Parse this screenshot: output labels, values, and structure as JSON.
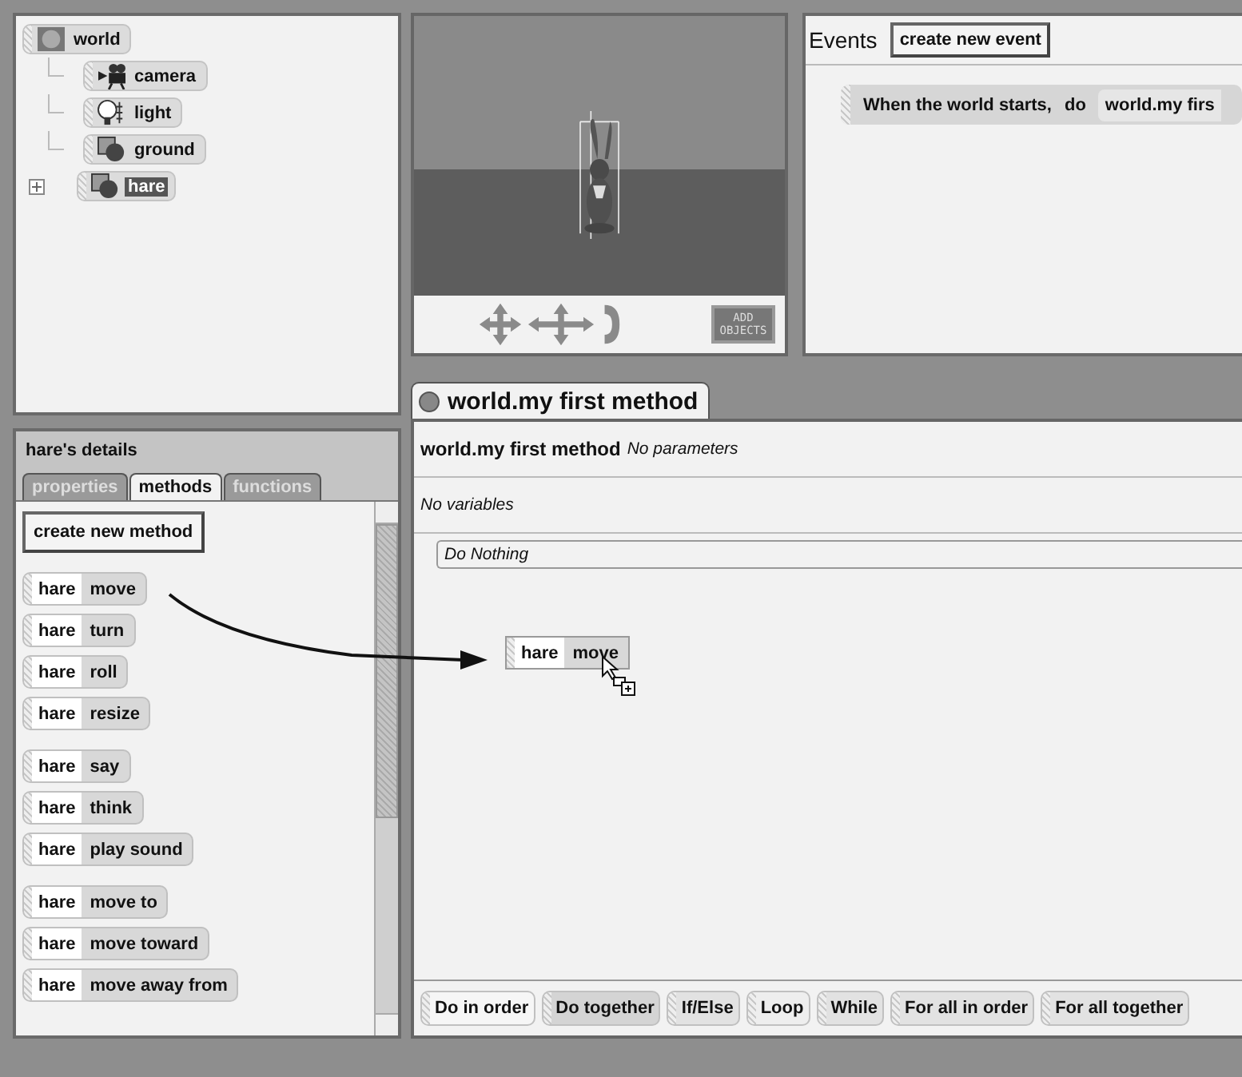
{
  "object_tree": {
    "root": {
      "label": "world",
      "kind": "world",
      "selected": false,
      "children": [
        {
          "label": "camera",
          "kind": "camera",
          "selected": false,
          "expandable": false
        },
        {
          "label": "light",
          "kind": "light",
          "selected": false,
          "expandable": false
        },
        {
          "label": "ground",
          "kind": "object",
          "selected": false,
          "expandable": false
        },
        {
          "label": "hare",
          "kind": "object",
          "selected": true,
          "expandable": true
        }
      ]
    }
  },
  "scene": {
    "add_objects_button": "ADD OBJECTS"
  },
  "events": {
    "title": "Events",
    "create_button": "create new event",
    "items": [
      {
        "trigger": "When the world starts,",
        "do_label": "do",
        "method": "world.my firs"
      }
    ]
  },
  "details": {
    "title": "hare's details",
    "tabs": [
      {
        "label": "properties",
        "selected": false
      },
      {
        "label": "methods",
        "selected": true
      },
      {
        "label": "functions",
        "selected": false
      }
    ],
    "create_button": "create new method",
    "method_groups": [
      [
        {
          "object": "hare",
          "method": "move"
        },
        {
          "object": "hare",
          "method": "turn"
        },
        {
          "object": "hare",
          "method": "roll"
        },
        {
          "object": "hare",
          "method": "resize"
        }
      ],
      [
        {
          "object": "hare",
          "method": "say"
        },
        {
          "object": "hare",
          "method": "think"
        },
        {
          "object": "hare",
          "method": "play sound"
        }
      ],
      [
        {
          "object": "hare",
          "method": "move to"
        },
        {
          "object": "hare",
          "method": "move toward"
        },
        {
          "object": "hare",
          "method": "move away from"
        }
      ]
    ]
  },
  "editor": {
    "tab": "world.my first method",
    "method_name": "world.my first method",
    "parameters": "No parameters",
    "variables": "No variables",
    "body": "Do Nothing",
    "dragged_tile": {
      "object": "hare",
      "method": "move"
    },
    "statements": [
      {
        "label": "Do in order",
        "color": "#f6f6f6"
      },
      {
        "label": "Do together",
        "color": "#d4d4d4"
      },
      {
        "label": "If/Else",
        "color": "#e2e2e2"
      },
      {
        "label": "Loop",
        "color": "#eeeeee"
      },
      {
        "label": "While",
        "color": "#e2e2e2"
      },
      {
        "label": "For all in order",
        "color": "#e2e2e2"
      },
      {
        "label": "For all together",
        "color": "#e2e2e2"
      }
    ]
  }
}
